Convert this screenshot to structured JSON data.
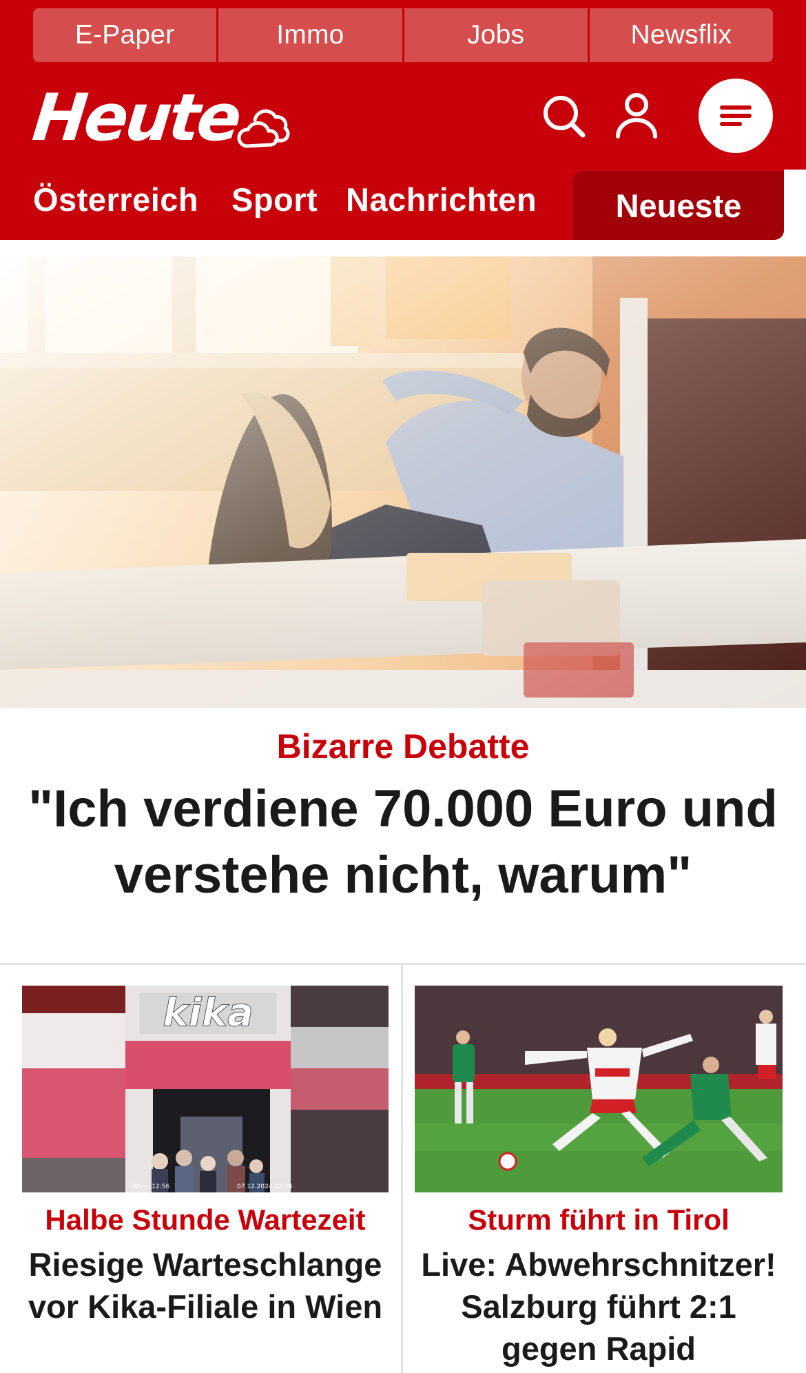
{
  "topbar": {
    "items": [
      "E-Paper",
      "Immo",
      "Jobs",
      "Newsflix"
    ]
  },
  "header": {
    "logo": "Heute",
    "icons": [
      "cloud-icon",
      "search-icon",
      "user-icon",
      "menu-icon"
    ]
  },
  "nav": {
    "items": [
      "Österreich",
      "Sport",
      "Nachrichten"
    ],
    "active": "Neueste"
  },
  "hero": {
    "kicker": "Bizarre Debatte",
    "title": "\"Ich verdiene 70.000 Euro und verstehe nicht, warum\"",
    "image": "man-relaxing-feet-on-desk-photo"
  },
  "cards": [
    {
      "kicker": "Halbe Stunde Wartezeit",
      "title": "Riesige Warteschlange vor Kika-Filiale in Wien",
      "image_sign": "kika",
      "image_caption_left": "Wien, 12:56",
      "image_caption_right": "07.12.2024 12:14"
    },
    {
      "kicker": "Sturm führt in Tirol",
      "title": "Live: Abwehrschnitzer! Salzburg führt 2:1 gegen Rapid",
      "image": "football-match-photo"
    }
  ],
  "colors": {
    "brand_red": "#c8000a",
    "dark_red": "#a10008",
    "topbar_item": "#d64d4d",
    "text": "#1a1a1a"
  }
}
